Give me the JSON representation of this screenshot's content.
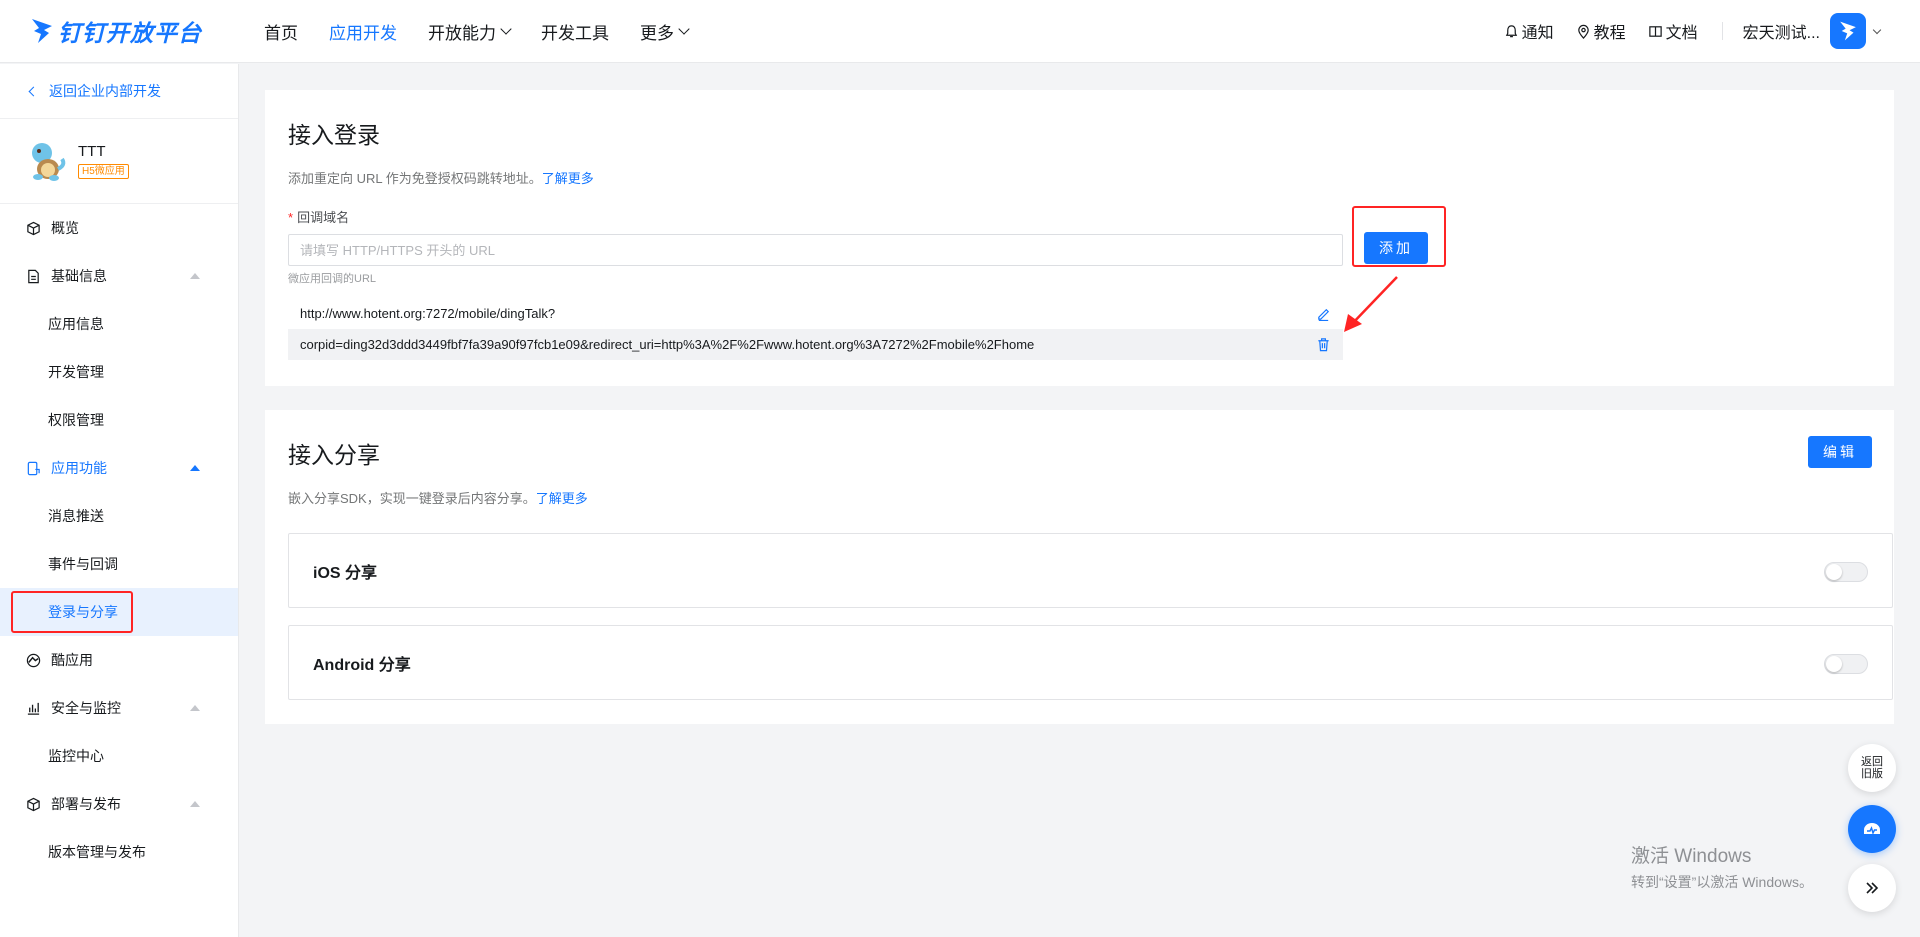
{
  "brand": {
    "name": "钉钉开放平台",
    "color": "#1677ff"
  },
  "nav": {
    "items": [
      {
        "label": "首页",
        "has_dropdown": false,
        "active": false
      },
      {
        "label": "应用开发",
        "has_dropdown": false,
        "active": true
      },
      {
        "label": "开放能力",
        "has_dropdown": true,
        "active": false
      },
      {
        "label": "开发工具",
        "has_dropdown": false,
        "active": false
      },
      {
        "label": "更多",
        "has_dropdown": true,
        "active": false
      }
    ],
    "right": {
      "notice": "通知",
      "tutorial": "教程",
      "docs": "文档",
      "user": "宏天测试..."
    }
  },
  "sidebar": {
    "back_label": "返回企业内部开发",
    "app": {
      "name": "TTT",
      "badge": "H5微应用"
    },
    "menu": {
      "overview": "概览",
      "basic_info": "基础信息",
      "app_info": "应用信息",
      "dev_manage": "开发管理",
      "perm_manage": "权限管理",
      "app_features": "应用功能",
      "message_push": "消息推送",
      "events": "事件与回调",
      "login_share": "登录与分享",
      "cool_app": "酷应用",
      "security": "安全与监控",
      "monitor": "监控中心",
      "deploy": "部署与发布",
      "version": "版本管理与发布"
    }
  },
  "login_section": {
    "title": "接入登录",
    "desc": "添加重定向 URL 作为免登授权码跳转地址。",
    "learn_more": "了解更多",
    "field_label": "回调域名",
    "required_mark": "*",
    "placeholder": "请填写 HTTP/HTTPS 开头的 URL",
    "hint": "微应用回调的URL",
    "add_button": "添加",
    "urls": [
      "http://www.hotent.org:7272/mobile/dingTalk?",
      "corpid=ding32d3ddd3449fbf7fa39a90f97fcb1e09&redirect_uri=http%3A%2F%2Fwww.hotent.org%3A7272%2Fmobile%2Fhome"
    ]
  },
  "share_section": {
    "title": "接入分享",
    "desc": "嵌入分享SDK，实现一键登录后内容分享。",
    "learn_more": "了解更多",
    "edit_button": "编辑",
    "ios": {
      "label": "iOS 分享",
      "enabled": false
    },
    "android": {
      "label": "Android 分享",
      "enabled": false
    }
  },
  "float": {
    "old_version_line1": "返回",
    "old_version_line2": "旧版"
  },
  "watermark": {
    "line1": "激活 Windows",
    "line2": "转到“设置”以激活 Windows。"
  }
}
